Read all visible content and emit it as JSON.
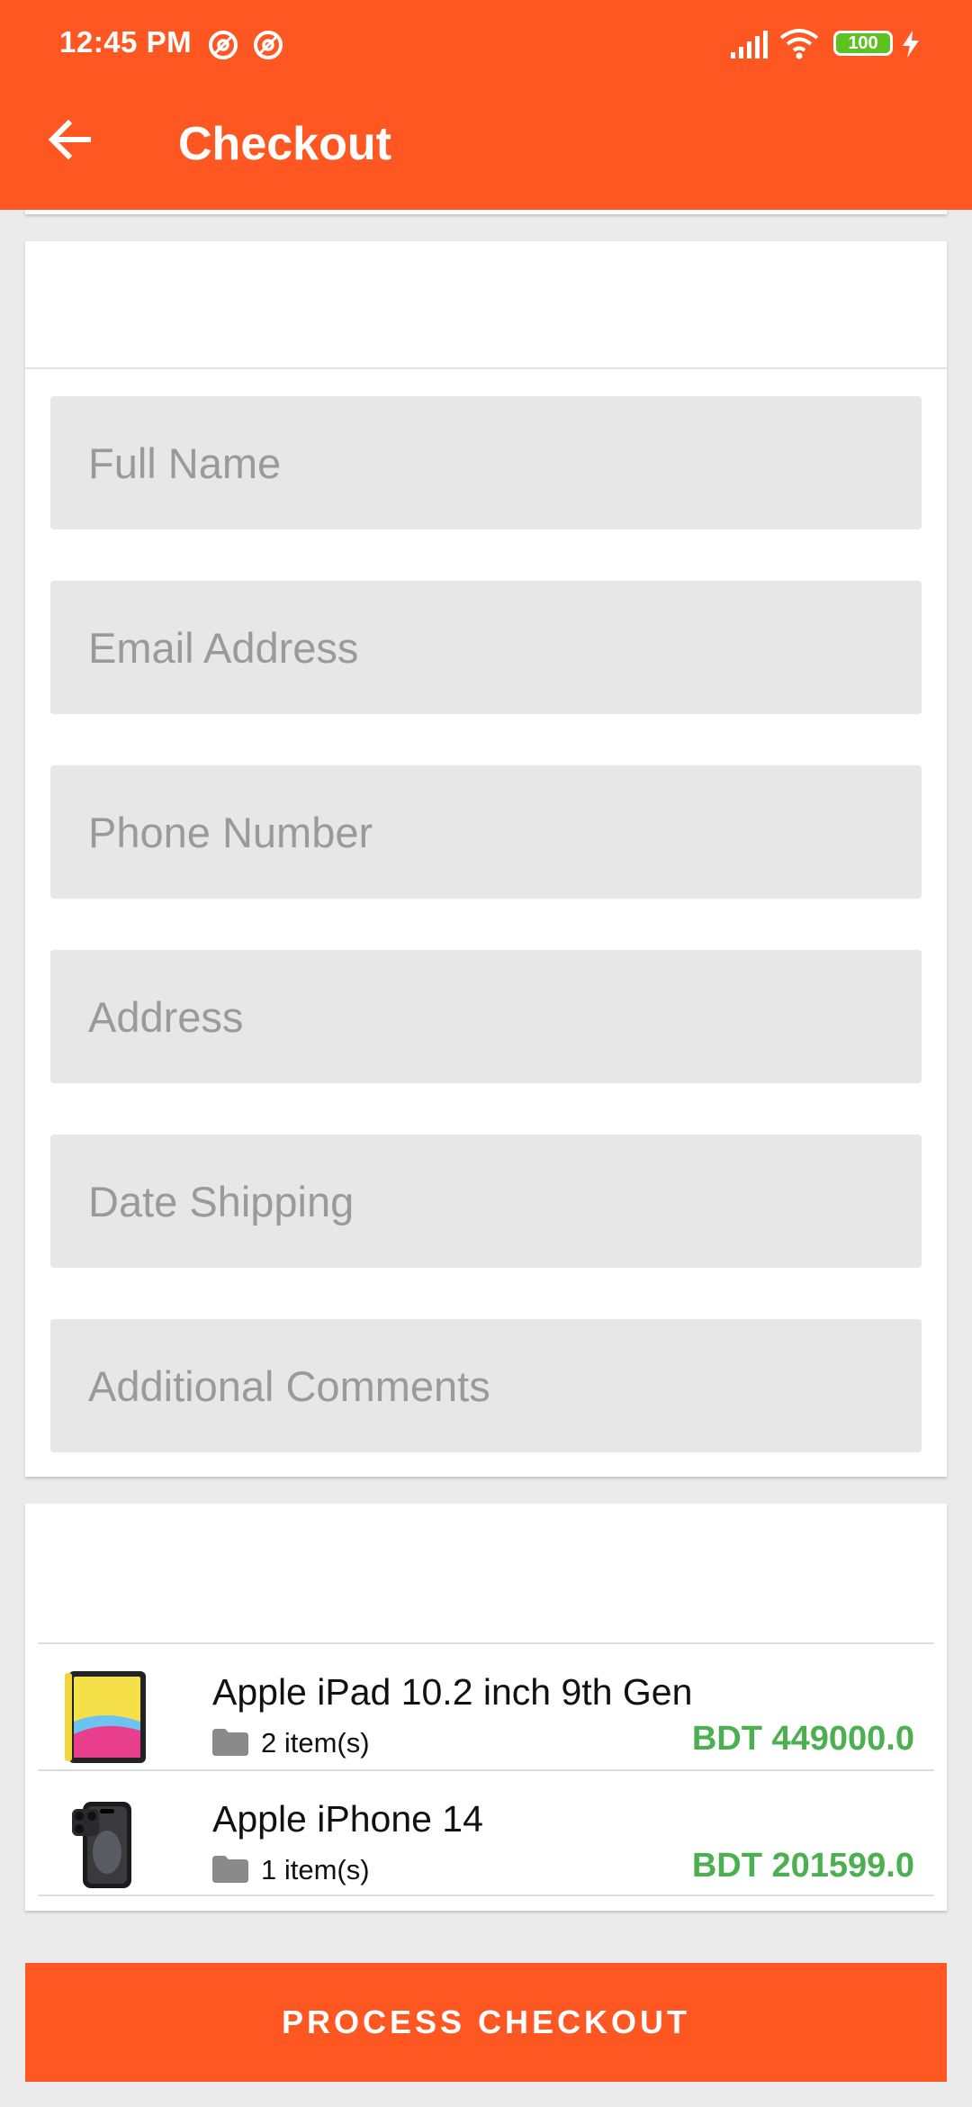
{
  "status_bar": {
    "time": "12:45 PM",
    "battery": "100",
    "icons": [
      "at-sign-icon",
      "at-sign-icon",
      "signal-icon",
      "wifi-icon",
      "battery-icon",
      "charging-icon"
    ]
  },
  "toolbar": {
    "title": "Checkout",
    "back_icon": "arrow-left-icon"
  },
  "form": {
    "fields": [
      {
        "placeholder": "Full Name",
        "value": ""
      },
      {
        "placeholder": "Email Address",
        "value": ""
      },
      {
        "placeholder": "Phone Number",
        "value": ""
      },
      {
        "placeholder": "Address",
        "value": ""
      },
      {
        "placeholder": "Date Shipping",
        "value": ""
      },
      {
        "placeholder": "Additional Comments",
        "value": ""
      }
    ]
  },
  "order": {
    "items": [
      {
        "name": "Apple iPad 10.2 inch 9th Gen",
        "quantity": "2 item(s)",
        "price": "BDT 449000.0",
        "image_icon": "ipad-icon"
      },
      {
        "name": "Apple iPhone 14",
        "quantity": "1 item(s)",
        "price": "BDT 201599.0",
        "image_icon": "iphone-icon"
      }
    ]
  },
  "actions": {
    "checkout_label": "PROCESS CHECKOUT"
  },
  "colors": {
    "primary": "#ff5722",
    "price": "#4caf50",
    "field_bg": "#e7e7e7",
    "page_bg": "#ebebeb"
  }
}
